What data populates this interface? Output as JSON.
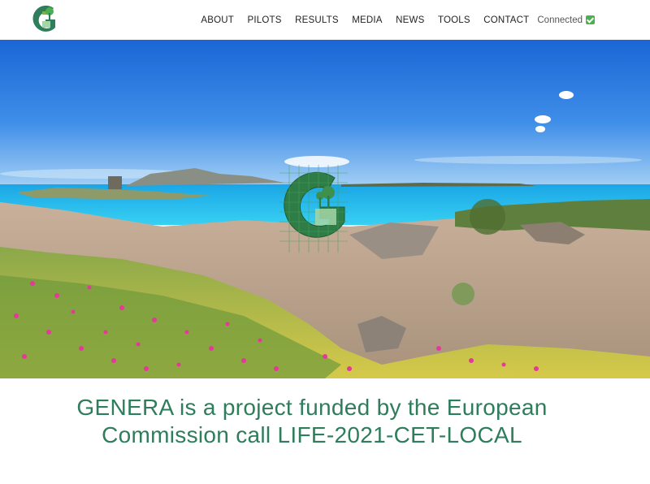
{
  "header": {
    "logo_icon": "genera-logo-icon",
    "nav": [
      {
        "label": "ABOUT"
      },
      {
        "label": "PILOTS"
      },
      {
        "label": "RESULTS"
      },
      {
        "label": "MEDIA"
      },
      {
        "label": "NEWS"
      },
      {
        "label": "TOOLS"
      },
      {
        "label": "CONTACT"
      }
    ],
    "status_text": "Connected",
    "status_icon": "check-icon"
  },
  "hero": {
    "image": "coastal-landscape-photo",
    "overlay_icon": "genera-solar-logo-icon"
  },
  "main": {
    "headline_line1": "GENERA is a project funded by the European",
    "headline_line2": "Commission call LIFE-2021-CET-LOCAL"
  },
  "colors": {
    "brand_green": "#2e7d5b",
    "nav_text": "#222222"
  }
}
